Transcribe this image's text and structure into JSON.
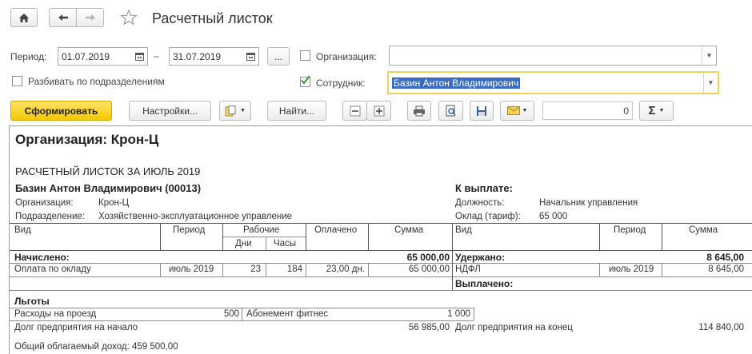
{
  "window": {
    "title": "Расчетный листок"
  },
  "toolbar_top": {
    "home_icon": "home-icon",
    "back_icon": "arrow-left-icon",
    "forward_icon": "arrow-right-icon",
    "favorite_icon": "star-icon"
  },
  "filters": {
    "period_label": "Период:",
    "date_from": "01.07.2019",
    "date_dash": "–",
    "date_to": "31.07.2019",
    "ellipsis_label": "...",
    "organization_label": "Организация:",
    "organization_value": "",
    "split_label": "Разбивать по подразделениям",
    "employee_label": "Сотрудник:",
    "employee_value": "Базин Антон Владимирович"
  },
  "actions": {
    "generate_label": "Сформировать",
    "settings_label": "Настройки...",
    "find_label": "Найти...",
    "number_value": "0",
    "sigma_label": "Σ"
  },
  "report": {
    "org_header": "Организация: Крон-Ц",
    "title": "РАСЧЕТНЫЙ ЛИСТОК ЗА ИЮЛЬ 2019",
    "employee": "Базин Антон Владимирович (00013)",
    "to_pay_label": "К выплате:",
    "org_label": "Организация:",
    "org_value": "Крон-Ц",
    "dept_label": "Подразделение:",
    "dept_value": "Хозяйственно-эксплуатационное управление",
    "position_label": "Должность:",
    "position_value": "Начальник управления",
    "salary_label": "Оклад (тариф):",
    "salary_value": "65 000",
    "left_headers": {
      "vid": "Вид",
      "period": "Период",
      "working": "Рабочие",
      "days": "Дни",
      "hours": "Часы",
      "paid": "Оплачено",
      "sum": "Сумма"
    },
    "right_headers": {
      "vid": "Вид",
      "period": "Период",
      "sum": "Сумма"
    },
    "accrued_label": "Начислено:",
    "accrued_total": "65 000,00",
    "accrual_row": {
      "vid": "Оплата по окладу",
      "period": "июль 2019",
      "days": "23",
      "hours": "184",
      "paid": "23,00 дн.",
      "sum": "65 000,00"
    },
    "withheld_label": "Удержано:",
    "withheld_total": "8 645,00",
    "withheld_row": {
      "vid": "НДФЛ",
      "period": "июль 2019",
      "sum": "8 645,00"
    },
    "paid_out_label": "Выплачено:",
    "benefits_label": "Льготы",
    "benefit1_name": "Расходы на проезд",
    "benefit1_value": "500",
    "benefit2_name": "Абонемент фитнес",
    "benefit2_value": "1 000",
    "debt_start_label": "Долг предприятия на начало",
    "debt_start_value": "56 985,00",
    "debt_end_label": "Долг предприятия на конец",
    "debt_end_value": "114 840,00",
    "taxable_income": "Общий облагаемый доход: 459 500,00"
  }
}
